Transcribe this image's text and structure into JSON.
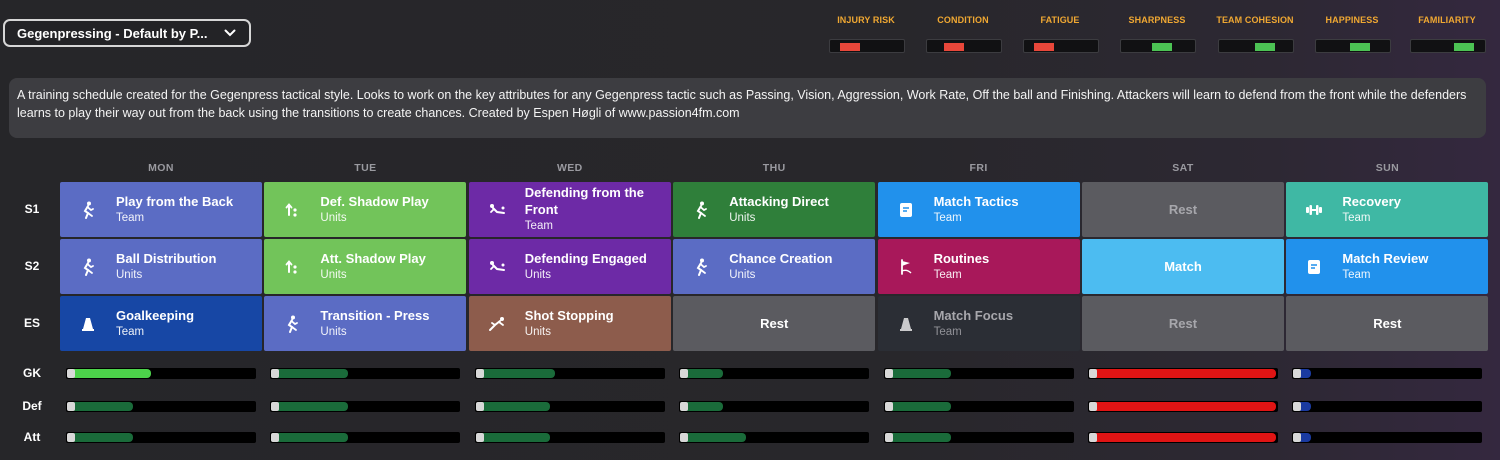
{
  "schedule_select": {
    "value": "Gegenpressing - Default by P...",
    "icon": "chevron-down-icon"
  },
  "meters": [
    {
      "label": "INJURY RISK",
      "level": "low",
      "color": "#e8473a",
      "fill": 0.27
    },
    {
      "label": "CONDITION",
      "level": "low",
      "color": "#e8473a",
      "fill": 0.37
    },
    {
      "label": "FATIGUE",
      "level": "low",
      "color": "#e8473a",
      "fill": 0.27
    },
    {
      "label": "SHARPNESS",
      "level": "medium",
      "color": "#4cc354",
      "fill": 0.55
    },
    {
      "label": "TEAM COHESION",
      "level": "medium",
      "color": "#4cc354",
      "fill": 0.62
    },
    {
      "label": "HAPPINESS",
      "level": "medium",
      "color": "#4cc354",
      "fill": 0.6
    },
    {
      "label": "FAMILIARITY",
      "level": "high",
      "color": "#4cc354",
      "fill": 0.72
    }
  ],
  "description": "A training schedule created for the Gegenpress tactical style. Looks to work on the key attributes for any Gegenpress tactic such as Passing, Vision, Aggression, Work Rate, Off the ball and Finishing. Attackers will learn to defend from the front while the defenders learns to play their way out from the back using the transitions to create chances. Created by Espen Høgli of www.passion4fm.com",
  "days": [
    "MON",
    "TUE",
    "WED",
    "THU",
    "FRI",
    "SAT",
    "SUN"
  ],
  "sessions": [
    "S1",
    "S2",
    "ES"
  ],
  "grid": [
    [
      {
        "name": "Play from the Back",
        "sub": "Team",
        "color": "#5b6cc4",
        "icon": "running-player-icon"
      },
      {
        "name": "Ball Distribution",
        "sub": "Units",
        "color": "#5b6cc4",
        "icon": "running-player-icon"
      },
      {
        "name": "Goalkeeping",
        "sub": "Team",
        "color": "#1747a5",
        "icon": "cone-icon"
      }
    ],
    [
      {
        "name": "Def. Shadow Play",
        "sub": "Units",
        "color": "#72c45a",
        "icon": "dots-arrow-icon"
      },
      {
        "name": "Att. Shadow Play",
        "sub": "Units",
        "color": "#72c45a",
        "icon": "dots-arrow-icon"
      },
      {
        "name": "Transition - Press",
        "sub": "Units",
        "color": "#5b6cc4",
        "icon": "running-player-icon"
      }
    ],
    [
      {
        "name": "Defending from the Front",
        "sub": "Team",
        "color": "#6d2aa6",
        "icon": "sliding-tackle-icon"
      },
      {
        "name": "Defending Engaged",
        "sub": "Units",
        "color": "#6d2aa6",
        "icon": "sliding-tackle-icon"
      },
      {
        "name": "Shot Stopping",
        "sub": "Units",
        "color": "#8d5c4c",
        "icon": "diving-keeper-icon"
      }
    ],
    [
      {
        "name": "Attacking Direct",
        "sub": "Units",
        "color": "#2f7f3a",
        "icon": "running-player-icon"
      },
      {
        "name": "Chance Creation",
        "sub": "Units",
        "color": "#5b6cc4",
        "icon": "running-player-icon"
      },
      {
        "name": "Rest",
        "sub": "",
        "color": "#5b5b60",
        "icon": "",
        "center": true
      }
    ],
    [
      {
        "name": "Match Tactics",
        "sub": "Team",
        "color": "#2191ec",
        "icon": "tactics-board-icon"
      },
      {
        "name": "Routines",
        "sub": "Team",
        "color": "#a8185a",
        "icon": "corner-flag-icon"
      },
      {
        "name": "Match Focus",
        "sub": "Team",
        "color": "#2b2e35",
        "icon": "cone-icon",
        "muted": true
      }
    ],
    [
      {
        "name": "Rest",
        "sub": "",
        "color": "#5b5b60",
        "icon": "",
        "center": true,
        "muted": true
      },
      {
        "name": "Match",
        "sub": "",
        "color": "#4cbcf1",
        "icon": "",
        "center": true
      },
      {
        "name": "Rest",
        "sub": "",
        "color": "#5b5b60",
        "icon": "",
        "center": true,
        "muted": true
      }
    ],
    [
      {
        "name": "Recovery",
        "sub": "Team",
        "color": "#3fb8a4",
        "icon": "dumbbell-icon"
      },
      {
        "name": "Match Review",
        "sub": "Team",
        "color": "#2191ec",
        "icon": "tactics-board-icon"
      },
      {
        "name": "Rest",
        "sub": "",
        "color": "#5b5b60",
        "icon": "",
        "center": true
      }
    ]
  ],
  "load_rows": [
    "GK",
    "Def",
    "Att"
  ],
  "load": [
    [
      {
        "fill": 0.43,
        "color": "#4cd24a"
      },
      {
        "fill": 0.33,
        "color": "#1a6b3a"
      },
      {
        "fill": 0.33,
        "color": "#1a6b3a"
      }
    ],
    [
      {
        "fill": 0.39,
        "color": "#1a6b3a"
      },
      {
        "fill": 0.39,
        "color": "#1a6b3a"
      },
      {
        "fill": 0.39,
        "color": "#1a6b3a"
      }
    ],
    [
      {
        "fill": 0.4,
        "color": "#1a6b3a"
      },
      {
        "fill": 0.37,
        "color": "#1a6b3a"
      },
      {
        "fill": 0.37,
        "color": "#1a6b3a"
      }
    ],
    [
      {
        "fill": 0.2,
        "color": "#1a6b3a"
      },
      {
        "fill": 0.2,
        "color": "#1a6b3a"
      },
      {
        "fill": 0.33,
        "color": "#1a6b3a"
      }
    ],
    [
      {
        "fill": 0.33,
        "color": "#1a6b3a"
      },
      {
        "fill": 0.33,
        "color": "#1a6b3a"
      },
      {
        "fill": 0.33,
        "color": "#1a6b3a"
      }
    ],
    [
      {
        "fill": 1.0,
        "color": "#e01414"
      },
      {
        "fill": 1.0,
        "color": "#e01414"
      },
      {
        "fill": 1.0,
        "color": "#e01414"
      }
    ],
    [
      {
        "fill": 0.06,
        "color": "#1a3aa0"
      },
      {
        "fill": 0.06,
        "color": "#1a3aa0"
      },
      {
        "fill": 0.06,
        "color": "#1a3aa0"
      }
    ]
  ]
}
